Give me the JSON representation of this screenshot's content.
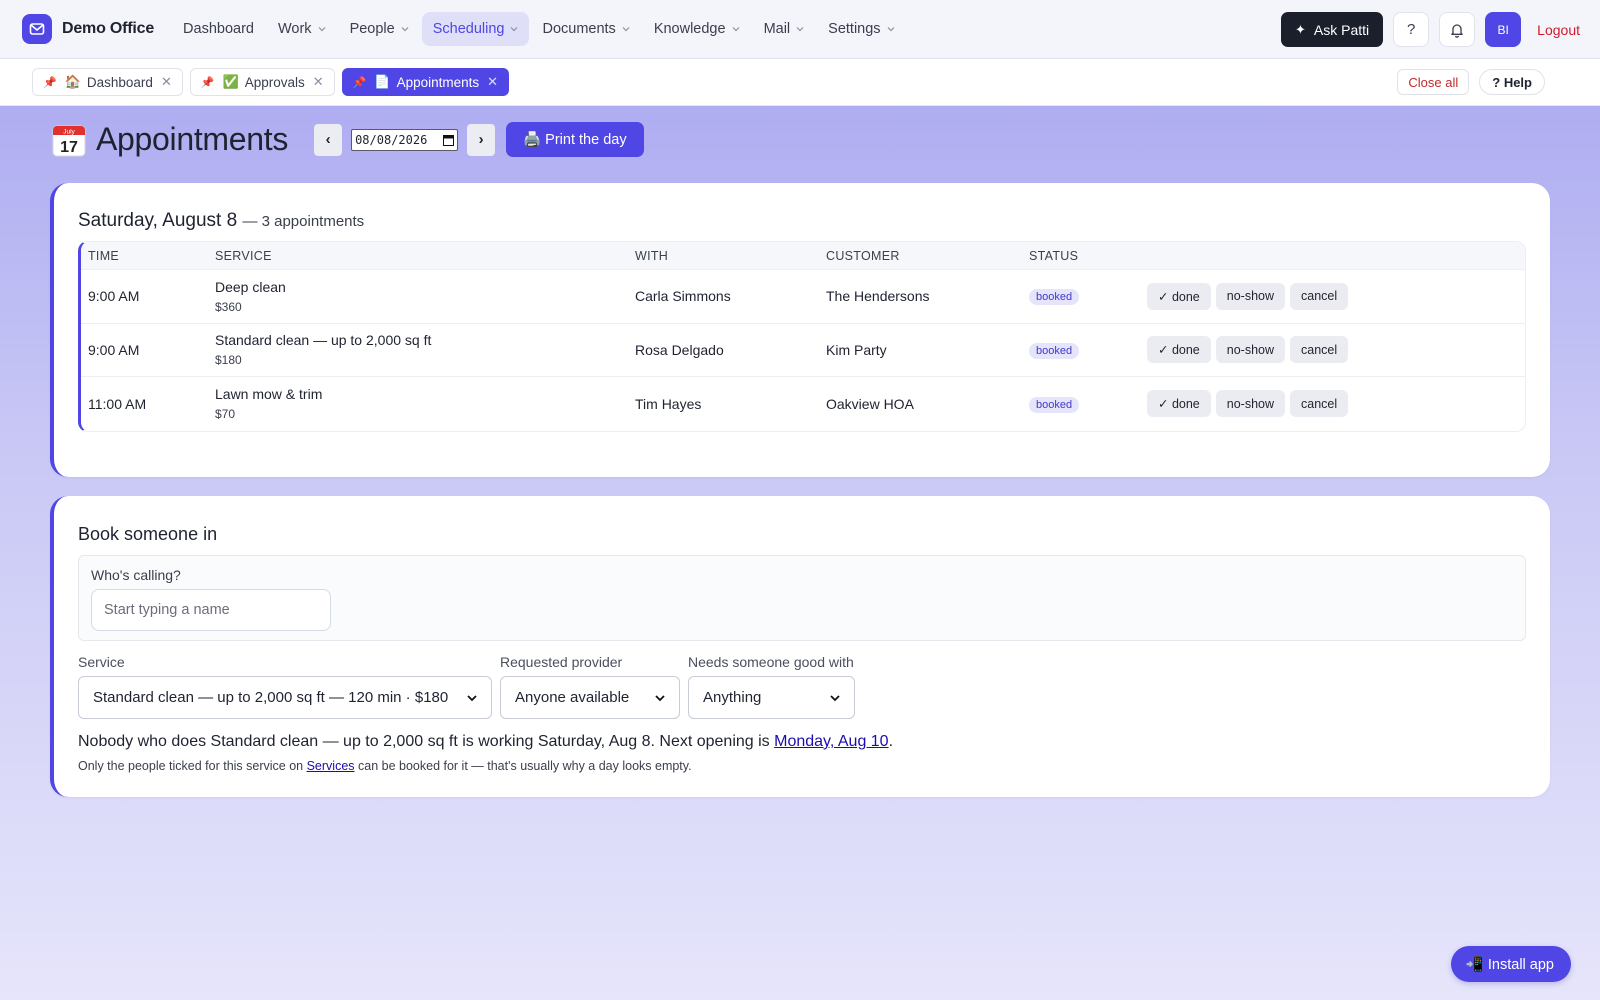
{
  "app": {
    "name": "Demo Office"
  },
  "nav": {
    "items": [
      {
        "label": "Dashboard",
        "has_menu": false
      },
      {
        "label": "Work",
        "has_menu": true
      },
      {
        "label": "People",
        "has_menu": true
      },
      {
        "label": "Scheduling",
        "has_menu": true,
        "active": true
      },
      {
        "label": "Documents",
        "has_menu": true
      },
      {
        "label": "Knowledge",
        "has_menu": true
      },
      {
        "label": "Mail",
        "has_menu": true
      },
      {
        "label": "Settings",
        "has_menu": true
      }
    ],
    "ask_label": "Ask Patti",
    "help_label": "?",
    "avatar_initials": "BI",
    "logout_label": "Logout"
  },
  "tabs": {
    "items": [
      {
        "emoji": "🏠",
        "label": "Dashboard"
      },
      {
        "emoji": "✅",
        "label": "Approvals"
      },
      {
        "emoji": "📄",
        "label": "Appointments",
        "active": true
      }
    ],
    "close_all_label": "Close all",
    "help_label": "? Help"
  },
  "page": {
    "title": "Appointments",
    "calendar_month": "July",
    "calendar_day": "17",
    "prev_label": "‹",
    "next_label": "›",
    "date_value": "08/08/2026",
    "print_label": "🖨️ Print the day"
  },
  "schedule": {
    "day_label": "Saturday, August 8",
    "count_label": "— 3 appointments",
    "columns": [
      "TIME",
      "SERVICE",
      "WITH",
      "CUSTOMER",
      "STATUS"
    ],
    "rows": [
      {
        "time": "9:00 AM",
        "service": "Deep clean",
        "price": "$360",
        "with": "Carla Simmons",
        "customer": "The Hendersons",
        "status": "booked"
      },
      {
        "time": "9:00 AM",
        "service": "Standard clean — up to 2,000 sq ft",
        "price": "$180",
        "with": "Rosa Delgado",
        "customer": "Kim Party",
        "status": "booked"
      },
      {
        "time": "11:00 AM",
        "service": "Lawn mow & trim",
        "price": "$70",
        "with": "Tim Hayes",
        "customer": "Oakview HOA",
        "status": "booked"
      }
    ],
    "actions": {
      "done": "✓ done",
      "noshow": "no-show",
      "cancel": "cancel"
    }
  },
  "booking": {
    "title": "Book someone in",
    "caller_label": "Who's calling?",
    "caller_placeholder": "Start typing a name",
    "service_label": "Service",
    "service_value": "Standard clean — up to 2,000 sq ft — 120 min · $180",
    "provider_label": "Requested provider",
    "provider_value": "Anyone available",
    "skill_label": "Needs someone good with",
    "skill_value": "Anything",
    "notice_text": "Nobody who does Standard clean — up to 2,000 sq ft is working Saturday, Aug 8. Next opening is ",
    "notice_link": "Monday, Aug 10",
    "notice_end": ".",
    "hint_pre": "Only the people ticked for this service on ",
    "hint_link": "Services",
    "hint_post": " can be booked for it — that's usually why a day looks empty."
  },
  "install_label": "📲 Install app",
  "colors": {
    "accent": "#4f46e5",
    "danger": "#d11a2a",
    "dark": "#1b1e2b"
  }
}
